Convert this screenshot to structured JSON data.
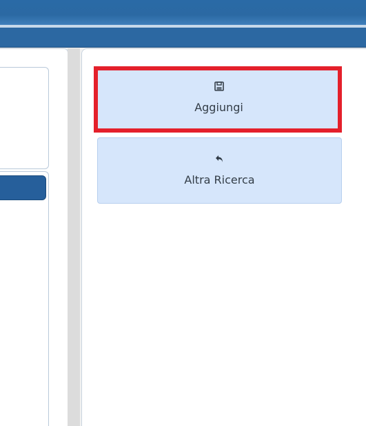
{
  "actions": {
    "add_label": "Aggiungi",
    "add_icon": "floppy-disk-icon",
    "back_label": "Altra Ricerca",
    "back_icon": "reply-arrow-icon"
  },
  "colors": {
    "header_blue": "#2c68a2",
    "button_bg": "#d6e6fb",
    "highlight": "#e4202b"
  }
}
